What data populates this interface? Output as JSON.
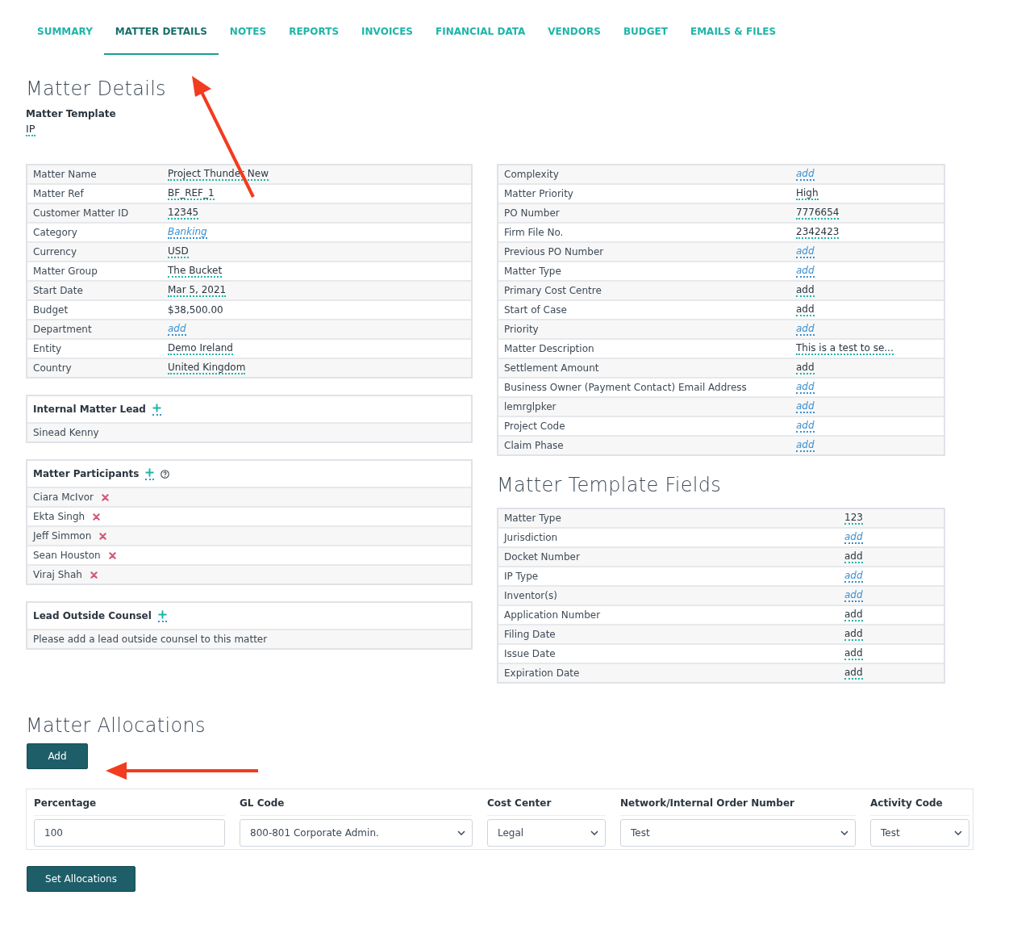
{
  "tabs": [
    {
      "label": "SUMMARY",
      "selected": false
    },
    {
      "label": "MATTER DETAILS",
      "selected": true
    },
    {
      "label": "NOTES",
      "selected": false
    },
    {
      "label": "REPORTS",
      "selected": false
    },
    {
      "label": "INVOICES",
      "selected": false
    },
    {
      "label": "FINANCIAL DATA",
      "selected": false
    },
    {
      "label": "VENDORS",
      "selected": false
    },
    {
      "label": "BUDGET",
      "selected": false
    },
    {
      "label": "EMAILS & FILES",
      "selected": false
    }
  ],
  "page_title": "Matter Details",
  "matter_template": {
    "label": "Matter Template",
    "value": "IP"
  },
  "details": [
    {
      "label": "Matter Name",
      "value": "Project Thunder New",
      "kind": "text"
    },
    {
      "label": "Matter Ref",
      "value": "BF_REF_1",
      "kind": "text"
    },
    {
      "label": "Customer Matter ID",
      "value": "12345",
      "kind": "text"
    },
    {
      "label": "Category",
      "value": "Banking",
      "kind": "link"
    },
    {
      "label": "Currency",
      "value": "USD",
      "kind": "text"
    },
    {
      "label": "Matter Group",
      "value": "The Bucket",
      "kind": "text"
    },
    {
      "label": "Start Date",
      "value": "Mar 5, 2021",
      "kind": "text"
    },
    {
      "label": "Budget",
      "value": "$38,500.00",
      "kind": "plain"
    },
    {
      "label": "Department",
      "value": "add",
      "kind": "link"
    },
    {
      "label": "Entity",
      "value": "Demo Ireland",
      "kind": "text"
    },
    {
      "label": "Country",
      "value": "United Kingdom",
      "kind": "text"
    }
  ],
  "people_panels": [
    {
      "title": "Internal Matter Lead",
      "help": false,
      "entries": [
        {
          "name": "Sinead Kenny",
          "removable": false
        }
      ]
    },
    {
      "title": "Matter Participants",
      "help": true,
      "entries": [
        {
          "name": "Ciara McIvor",
          "removable": true
        },
        {
          "name": "Ekta Singh",
          "removable": true
        },
        {
          "name": "Jeff Simmon",
          "removable": true
        },
        {
          "name": "Sean Houston",
          "removable": true
        },
        {
          "name": "Viraj Shah",
          "removable": true
        }
      ]
    },
    {
      "title": "Lead Outside Counsel",
      "help": false,
      "entries": [
        {
          "name": "Please add a lead outside counsel to this matter",
          "removable": false
        }
      ]
    }
  ],
  "extra_fields": [
    {
      "label": "Complexity",
      "value": "add",
      "kind": "link"
    },
    {
      "label": "Matter Priority",
      "value": "High",
      "kind": "text"
    },
    {
      "label": "PO Number",
      "value": "7776654",
      "kind": "text"
    },
    {
      "label": "Firm File No.",
      "value": "2342423",
      "kind": "text"
    },
    {
      "label": "Previous PO Number",
      "value": "add",
      "kind": "link"
    },
    {
      "label": "Matter Type",
      "value": "add",
      "kind": "link"
    },
    {
      "label": "Primary Cost Centre",
      "value": "add",
      "kind": "text"
    },
    {
      "label": "Start of Case",
      "value": "add",
      "kind": "text"
    },
    {
      "label": "Priority",
      "value": "add",
      "kind": "link"
    },
    {
      "label": "Matter Description",
      "value": "This is a test to se...",
      "kind": "text"
    },
    {
      "label": "Settlement Amount",
      "value": "add",
      "kind": "text"
    },
    {
      "label": "Business Owner (Payment Contact) Email Address",
      "value": "add",
      "kind": "link"
    },
    {
      "label": "lemrglpker",
      "value": "add",
      "kind": "link"
    },
    {
      "label": "Project Code",
      "value": "add",
      "kind": "link"
    },
    {
      "label": "Claim Phase",
      "value": "add",
      "kind": "link"
    }
  ],
  "template_fields": {
    "title": "Matter Template Fields",
    "rows": [
      {
        "label": "Matter Type",
        "value": "123",
        "kind": "text"
      },
      {
        "label": "Jurisdiction",
        "value": "add",
        "kind": "link"
      },
      {
        "label": "Docket Number",
        "value": "add",
        "kind": "text"
      },
      {
        "label": "IP Type",
        "value": "add",
        "kind": "link"
      },
      {
        "label": "Inventor(s)",
        "value": "add",
        "kind": "link"
      },
      {
        "label": "Application Number",
        "value": "add",
        "kind": "text"
      },
      {
        "label": "Filing Date",
        "value": "add",
        "kind": "text"
      },
      {
        "label": "Issue Date",
        "value": "add",
        "kind": "text"
      },
      {
        "label": "Expiration Date",
        "value": "add",
        "kind": "text"
      }
    ]
  },
  "allocations": {
    "title": "Matter Allocations",
    "add_button": "Add",
    "columns": [
      {
        "header": "Percentage",
        "value": "100",
        "kind": "input"
      },
      {
        "header": "GL Code",
        "value": "800-801 Corporate Admin.",
        "kind": "select"
      },
      {
        "header": "Cost Center",
        "value": "Legal",
        "kind": "select"
      },
      {
        "header": "Network/Internal Order Number",
        "value": "Test",
        "kind": "select"
      },
      {
        "header": "Activity Code",
        "value": "Test",
        "kind": "select"
      }
    ],
    "submit_button": "Set Allocations"
  }
}
